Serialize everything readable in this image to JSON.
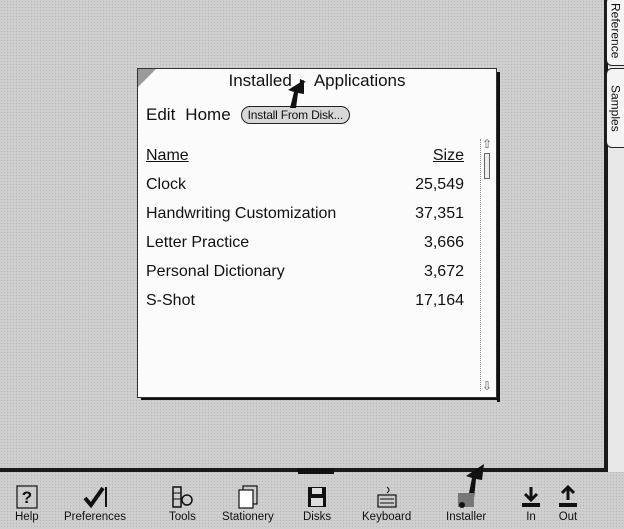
{
  "window": {
    "title_left": "Installed",
    "title_separator": "▸",
    "title_right": "Applications",
    "menu": {
      "edit": "Edit",
      "home": "Home",
      "install_button": "Install From Disk..."
    },
    "columns": {
      "name": "Name",
      "size": "Size"
    },
    "rows": [
      {
        "name": "Clock",
        "size": "25,549"
      },
      {
        "name": "Handwriting Customization",
        "size": "37,351"
      },
      {
        "name": "Letter Practice",
        "size": "3,666"
      },
      {
        "name": "Personal Dictionary",
        "size": "3,672"
      },
      {
        "name": "S-Shot",
        "size": "17,164"
      }
    ],
    "scroll_up": "⇧",
    "scroll_down": "⇩"
  },
  "side_tabs": {
    "reference": "Reference",
    "samples": "Samples"
  },
  "toolbar": {
    "items": [
      {
        "label": "Help",
        "icon": "question-icon"
      },
      {
        "label": "Preferences",
        "icon": "checkmark-icon"
      },
      {
        "label": "Tools",
        "icon": "tools-icon"
      },
      {
        "label": "Stationery",
        "icon": "stationery-icon"
      },
      {
        "label": "Disks",
        "icon": "disk-icon"
      },
      {
        "label": "Keyboard",
        "icon": "keyboard-icon"
      },
      {
        "label": "Installer",
        "icon": "installer-icon"
      },
      {
        "label": "In",
        "icon": "in-tray-icon"
      },
      {
        "label": "Out",
        "icon": "out-tray-icon"
      }
    ]
  }
}
